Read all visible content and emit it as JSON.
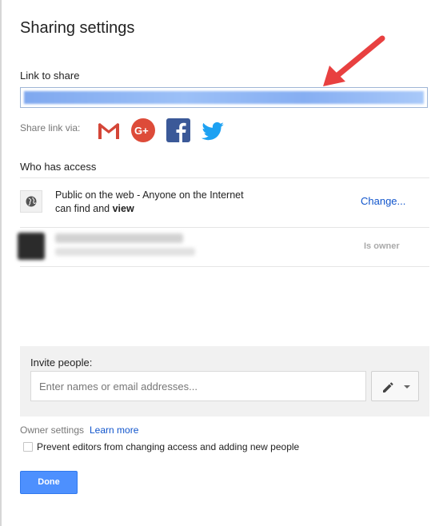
{
  "dialog": {
    "title": "Sharing settings"
  },
  "link": {
    "label": "Link to share"
  },
  "share_via": {
    "label": "Share link via:",
    "icons": [
      "gmail-icon",
      "google-plus-icon",
      "facebook-icon",
      "twitter-icon"
    ]
  },
  "access": {
    "label": "Who has access",
    "public_line1": "Public on the web - Anyone on the Internet",
    "public_line2_prefix": "can find and ",
    "public_line2_bold": "view",
    "change_label": "Change...",
    "owner_role": "Is owner"
  },
  "invite": {
    "label": "Invite people:",
    "placeholder": "Enter names or email addresses..."
  },
  "owner_settings": {
    "label": "Owner settings",
    "learn_more": "Learn more",
    "prevent_label": "Prevent editors from changing access and adding new people",
    "prevent_checked": false
  },
  "actions": {
    "done_label": "Done"
  },
  "colors": {
    "link": "#1155cc",
    "primary_button": "#4d90fe",
    "annotation_arrow": "#e84040"
  }
}
